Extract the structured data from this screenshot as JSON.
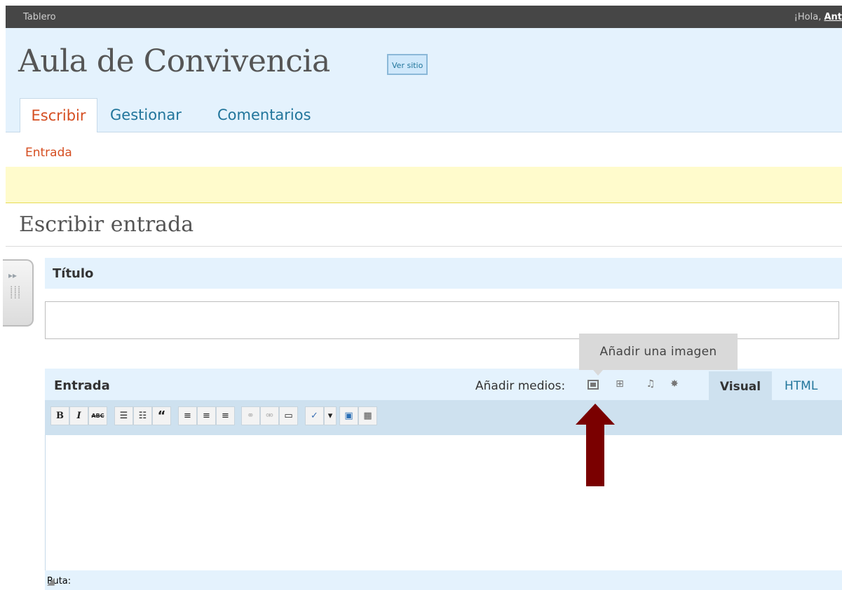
{
  "topbar": {
    "dashboard": "Tablero",
    "greeting": "¡Hola, ",
    "user": "Ant"
  },
  "header": {
    "site_title": "Aula de Convivencia",
    "view_site": "Ver sitio"
  },
  "tabs": [
    {
      "label": "Escribir",
      "active": true
    },
    {
      "label": "Gestionar",
      "active": false
    },
    {
      "label": "Comentarios",
      "active": false
    }
  ],
  "subtabs": [
    {
      "label": "Entrada",
      "active": true
    }
  ],
  "page": {
    "heading": "Escribir entrada"
  },
  "title_box": {
    "label": "Título",
    "value": ""
  },
  "entry_box": {
    "label": "Entrada",
    "add_media_label": "Añadir medios:",
    "media_icons": [
      "image-icon",
      "gallery-icon",
      "audio-icon",
      "media-icon"
    ],
    "editor_tabs": [
      "Visual",
      "HTML"
    ],
    "active_editor_tab": "Visual",
    "tooltip": "Añadir una imagen",
    "status_path": "Ruta:"
  },
  "toolbar": {
    "bold": "B",
    "italic": "I",
    "strikethrough": "ABC",
    "bullist": "☰",
    "numlist": "☷",
    "blockquote": "“",
    "justifyleft": "≡",
    "justifycenter": "≡",
    "justifyright": "≡",
    "link": "⚭",
    "unlink": "⚮",
    "more": "▭",
    "spellcheck": "✓",
    "dropdown": "▾",
    "fullscreen": "▣",
    "kitchensink": "▦"
  },
  "colors": {
    "topbar": "#464646",
    "header_bg": "#e4f2fd",
    "accent_orange": "#d54e21",
    "link_blue": "#21759b",
    "notice_yellow": "#fffbcc",
    "toolbar_bg": "#cee1ef",
    "annotation_arrow": "#7a0000"
  }
}
